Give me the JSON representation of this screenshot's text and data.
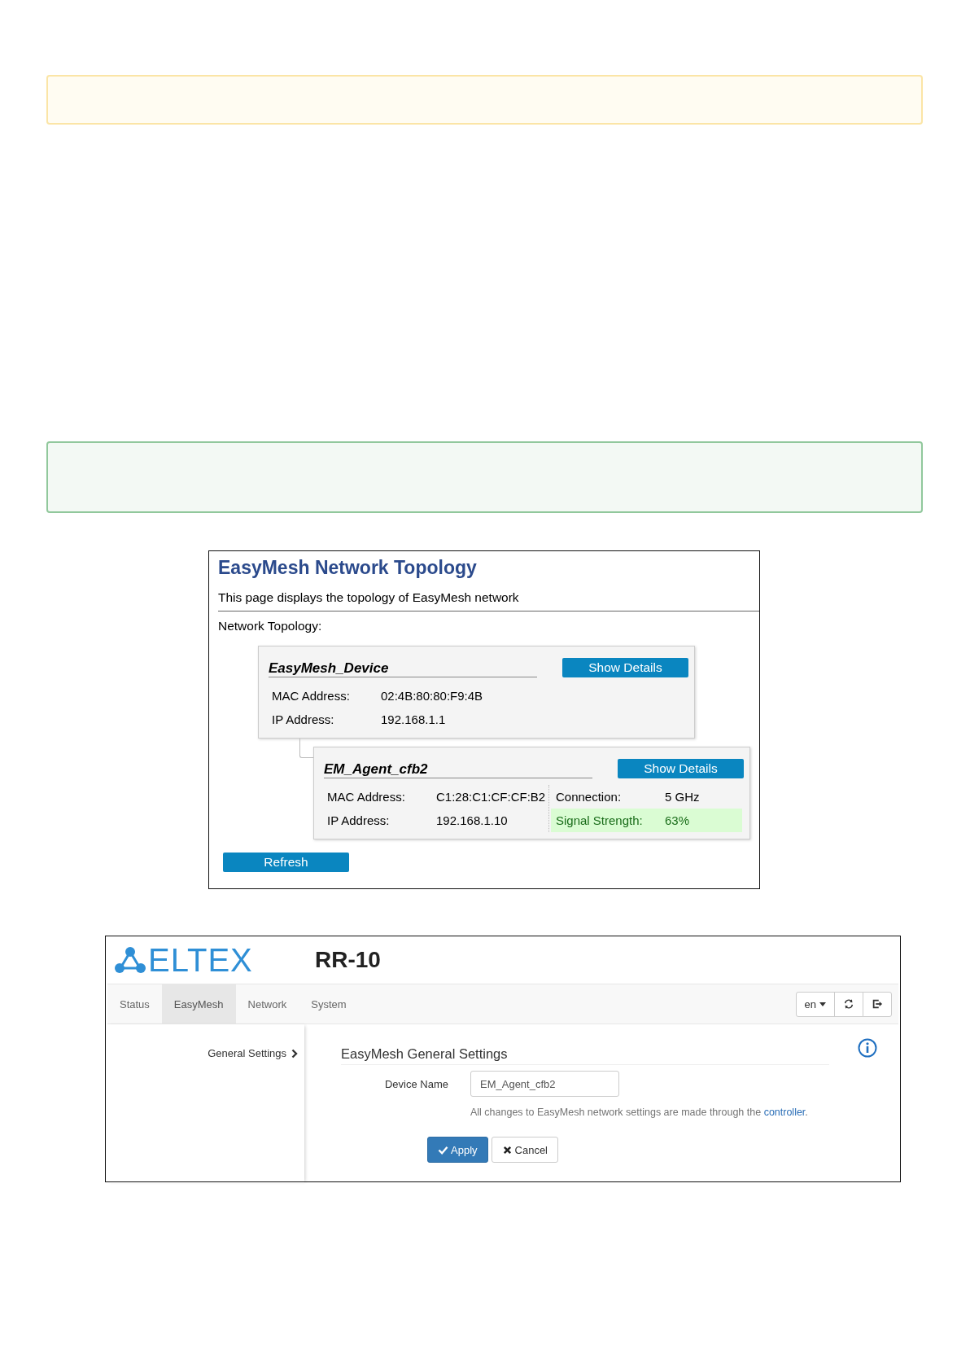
{
  "notes": [
    {
      "kind": "warning"
    },
    {
      "kind": "success"
    }
  ],
  "topology": {
    "title": "EasyMesh Network Topology",
    "subtitle": "This page displays the topology of EasyMesh network",
    "section_label": "Network Topology:",
    "devices": [
      {
        "name": "EasyMesh_Device",
        "button": "Show Details",
        "fields": [
          {
            "label": "MAC Address:",
            "value": "02:4B:80:80:F9:4B"
          },
          {
            "label": "IP Address:",
            "value": "192.168.1.1"
          }
        ],
        "children": [
          {
            "name": "EM_Agent_cfb2",
            "button": "Show Details",
            "fields": [
              {
                "label": "MAC Address:",
                "value": "C1:28:C1:CF:CF:B2"
              },
              {
                "label": "IP Address:",
                "value": "192.168.1.10"
              }
            ],
            "link_fields": [
              {
                "label": "Connection:",
                "value": "5 GHz",
                "highlighted": false
              },
              {
                "label": "Signal Strength:",
                "value": "63%",
                "highlighted": true
              }
            ]
          }
        ]
      }
    ],
    "refresh_button": "Refresh"
  },
  "router": {
    "logo_text": "ELTEX",
    "model": "RR-10",
    "tabs": [
      {
        "label": "Status",
        "selected": false
      },
      {
        "label": "EasyMesh",
        "selected": true
      },
      {
        "label": "Network",
        "selected": false
      },
      {
        "label": "System",
        "selected": false
      }
    ],
    "language": "en",
    "sidebar": [
      {
        "label": "General Settings",
        "selected": true
      }
    ],
    "heading": "EasyMesh General Settings",
    "form": {
      "label": "Device Name",
      "value": "EM_Agent_cfb2"
    },
    "note": "All changes to EasyMesh network settings are made through the",
    "note_link": "controller",
    "note_end": ".",
    "buttons": [
      {
        "kind": "apply",
        "label": "Apply"
      },
      {
        "kind": "cancel",
        "label": "Cancel"
      }
    ]
  }
}
